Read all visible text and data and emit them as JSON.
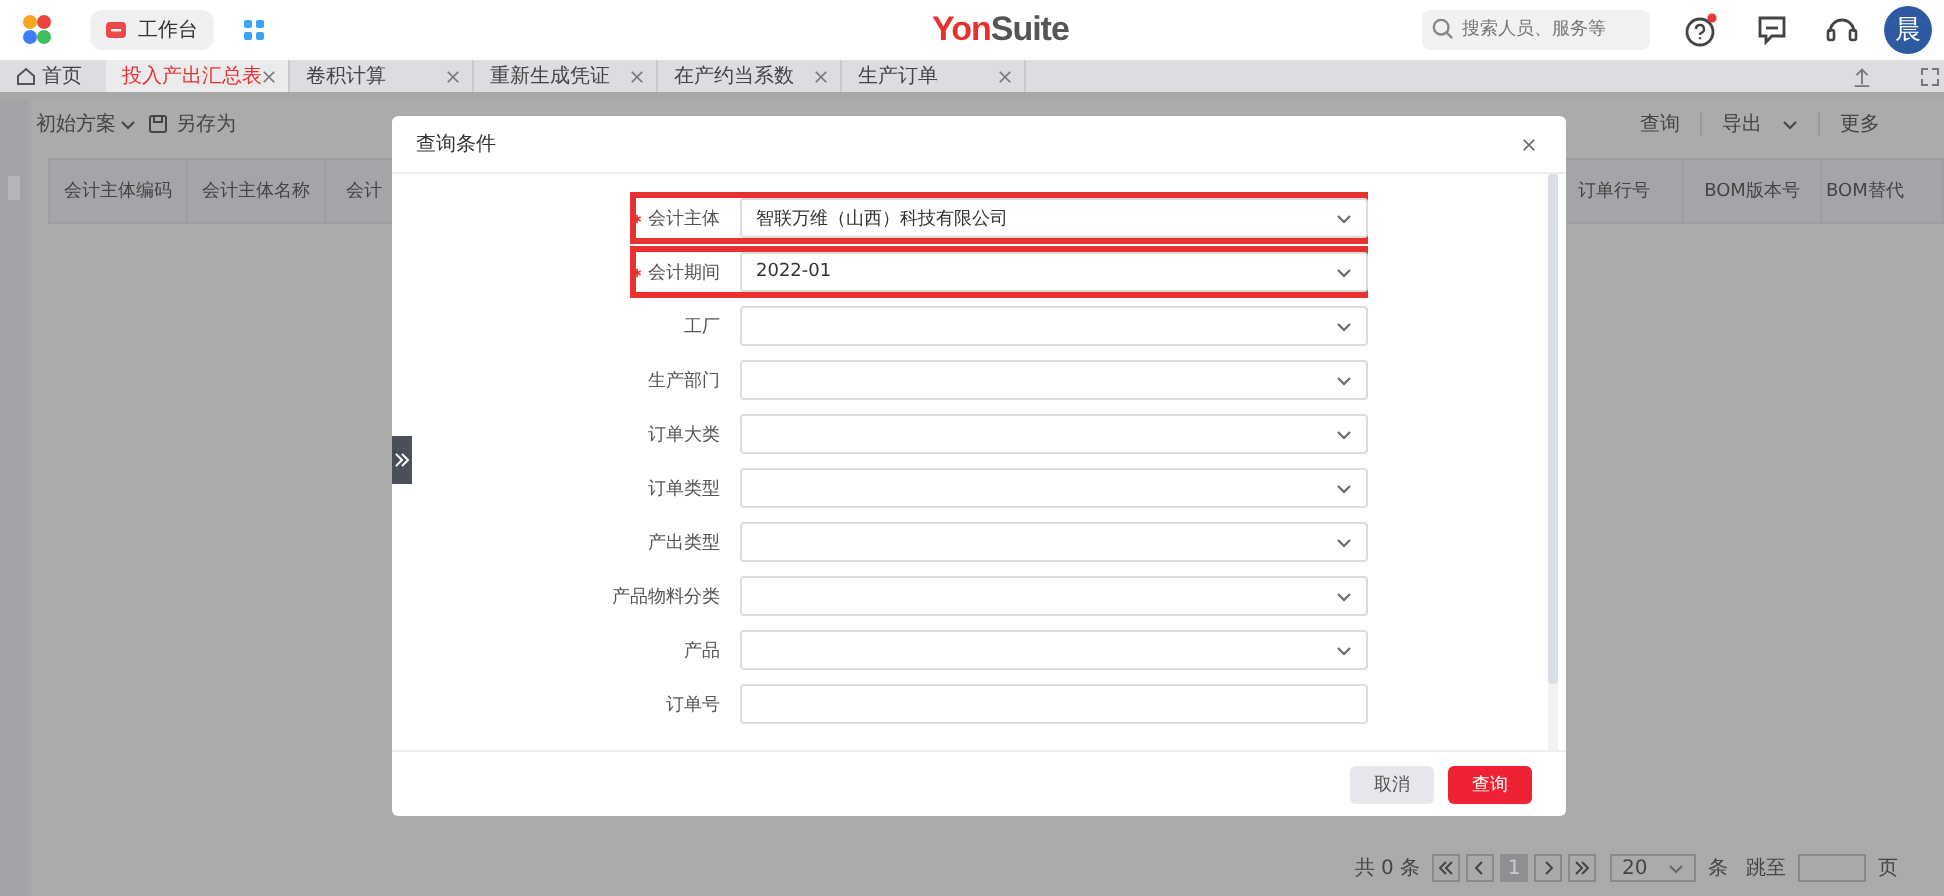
{
  "top_bar": {
    "workbench": "工作台",
    "logo": {
      "part_1": "Yon",
      "part_2": "Suite"
    },
    "search": {
      "placeholder": "搜索人员、服务等"
    },
    "help_unread": true,
    "avatar": "晨"
  },
  "tabs": [
    {
      "label": "首页",
      "kind": "home",
      "selected": false
    },
    {
      "label": "投入产出汇总表",
      "kind": "page",
      "selected": true
    },
    {
      "label": "卷积计算",
      "kind": "page",
      "selected": false
    },
    {
      "label": "重新生成凭证",
      "kind": "page",
      "selected": false
    },
    {
      "label": "在产约当系数",
      "kind": "page",
      "selected": false
    },
    {
      "label": "生产订单",
      "kind": "page",
      "selected": false
    }
  ],
  "toolbar": {
    "scheme": "初始方案",
    "save_as": "另存为",
    "actions": [
      {
        "label": "查询",
        "kind": "plain"
      },
      {
        "label": "导出",
        "kind": "menu"
      },
      {
        "label": "更多",
        "kind": "plain"
      }
    ]
  },
  "table": {
    "left_columns": [
      "会计主体编码",
      "会计主体名称",
      "会计"
    ],
    "right_columns": [
      "订单行号",
      "BOM版本号",
      "BOM替代"
    ]
  },
  "pagination": {
    "total": "共 0 条",
    "current_page": "1",
    "page_size": "20",
    "unit": "条",
    "goto": "跳至",
    "page_word": "页"
  },
  "dialog": {
    "title": "查询条件",
    "fields": [
      {
        "label": "会计主体",
        "kind": "select",
        "required": true,
        "highlighted": true,
        "value": "智联万维（山西）科技有限公司"
      },
      {
        "label": "会计期间",
        "kind": "select",
        "required": true,
        "highlighted": true,
        "value": "2022-01"
      },
      {
        "label": "工厂",
        "kind": "select",
        "required": false,
        "highlighted": false
      },
      {
        "label": "生产部门",
        "kind": "select",
        "required": false,
        "highlighted": false
      },
      {
        "label": "订单大类",
        "kind": "select",
        "required": false,
        "highlighted": false
      },
      {
        "label": "订单类型",
        "kind": "select",
        "required": false,
        "highlighted": false
      },
      {
        "label": "产出类型",
        "kind": "select",
        "required": false,
        "highlighted": false
      },
      {
        "label": "产品物料分类",
        "kind": "select",
        "required": false,
        "highlighted": false
      },
      {
        "label": "产品",
        "kind": "select",
        "required": false,
        "highlighted": false
      },
      {
        "label": "订单号",
        "kind": "text",
        "required": false,
        "highlighted": false
      }
    ],
    "buttons": [
      {
        "label": "取消",
        "primary": false
      },
      {
        "label": "查询",
        "primary": true
      }
    ]
  }
}
